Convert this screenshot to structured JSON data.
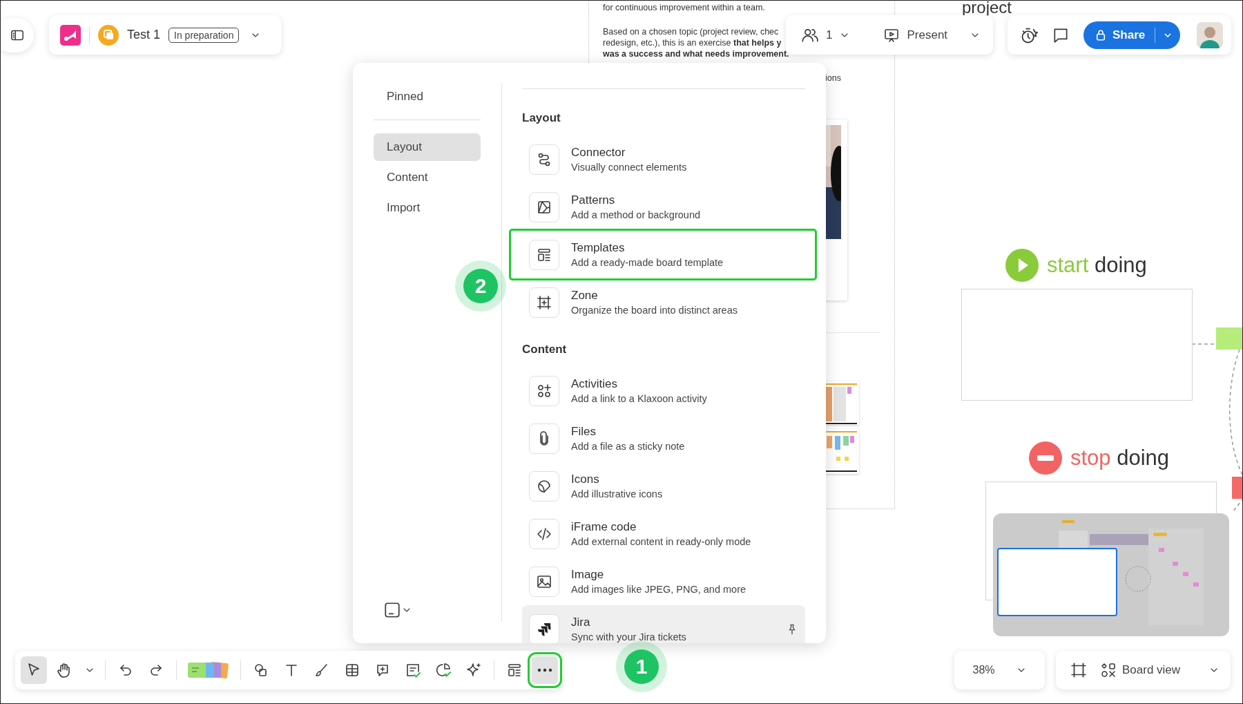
{
  "header": {
    "title": "Test 1",
    "status": "In preparation"
  },
  "participants": {
    "count": "1"
  },
  "present": {
    "label": "Present"
  },
  "share": {
    "label": "Share"
  },
  "canvas": {
    "heading": "project",
    "document_lines": [
      {
        "text": "for continuous improvement within a team.",
        "bold": false
      },
      {
        "text": "Based on a chosen topic (project review, chec",
        "bold": false
      },
      {
        "text": "redesign, etc.), this is an exercise **that helps y**",
        "bold": false
      },
      {
        "text": "was a success and what needs improvement.",
        "bold": true
      }
    ],
    "fragment": "ions",
    "sections": [
      {
        "kind": "start",
        "accent": "start",
        "word": "doing",
        "color": "#8acb3c"
      },
      {
        "kind": "stop",
        "accent": "stop",
        "word": "doing",
        "color": "#f26464"
      }
    ],
    "sticky_notes": [
      {
        "color": "#b5ec7a"
      },
      {
        "color": "#f46a6a"
      }
    ]
  },
  "menu": {
    "pinned": {
      "label": "Pinned",
      "selected": false
    },
    "categories": [
      {
        "label": "Layout",
        "selected": true
      },
      {
        "label": "Content",
        "selected": false
      },
      {
        "label": "Import",
        "selected": false
      }
    ],
    "groups": [
      {
        "heading": "Layout",
        "items": [
          {
            "title": "Connector",
            "description": "Visually connect elements",
            "highlighted": false,
            "hovered": false
          },
          {
            "title": "Patterns",
            "description": "Add a method or background",
            "highlighted": false,
            "hovered": false
          },
          {
            "title": "Templates",
            "description": "Add a ready-made board template",
            "highlighted": true,
            "hovered": false
          },
          {
            "title": "Zone",
            "description": "Organize the board into distinct areas",
            "highlighted": false,
            "hovered": false
          }
        ]
      },
      {
        "heading": "Content",
        "items": [
          {
            "title": "Activities",
            "description": "Add a link to a Klaxoon activity",
            "highlighted": false,
            "hovered": false
          },
          {
            "title": "Files",
            "description": "Add a file as a sticky note",
            "highlighted": false,
            "hovered": false
          },
          {
            "title": "Icons",
            "description": "Add illustrative icons",
            "highlighted": false,
            "hovered": false
          },
          {
            "title": "iFrame code",
            "description": "Add external content in ready-only mode",
            "highlighted": false,
            "hovered": false
          },
          {
            "title": "Image",
            "description": "Add images like JPEG, PNG, and more",
            "highlighted": false,
            "hovered": false
          },
          {
            "title": "Jira",
            "description": "Sync with your Jira tickets",
            "highlighted": false,
            "hovered": true
          }
        ]
      }
    ]
  },
  "toolbar": {
    "groups": [
      [
        {
          "selected": true,
          "highlighted": false
        },
        {
          "selected": false,
          "highlighted": false
        },
        {
          "selected": false,
          "highlighted": false
        }
      ],
      [
        {
          "selected": false,
          "highlighted": false
        },
        {
          "selected": false,
          "highlighted": false
        }
      ],
      [
        {
          "selected": false,
          "highlighted": false
        }
      ],
      [
        {
          "selected": false,
          "highlighted": false
        },
        {
          "selected": false,
          "highlighted": false
        },
        {
          "selected": false,
          "highlighted": false
        },
        {
          "selected": false,
          "highlighted": false
        },
        {
          "selected": false,
          "highlighted": false
        },
        {
          "selected": false,
          "highlighted": false
        },
        {
          "selected": false,
          "highlighted": false
        },
        {
          "selected": false,
          "highlighted": false
        }
      ],
      [
        {
          "selected": false,
          "highlighted": false
        },
        {
          "selected": true,
          "highlighted": true
        }
      ]
    ]
  },
  "zoom": {
    "value": "38%"
  },
  "view": {
    "label": "Board view"
  },
  "callouts": [
    {
      "number": "1"
    },
    {
      "number": "2"
    }
  ]
}
